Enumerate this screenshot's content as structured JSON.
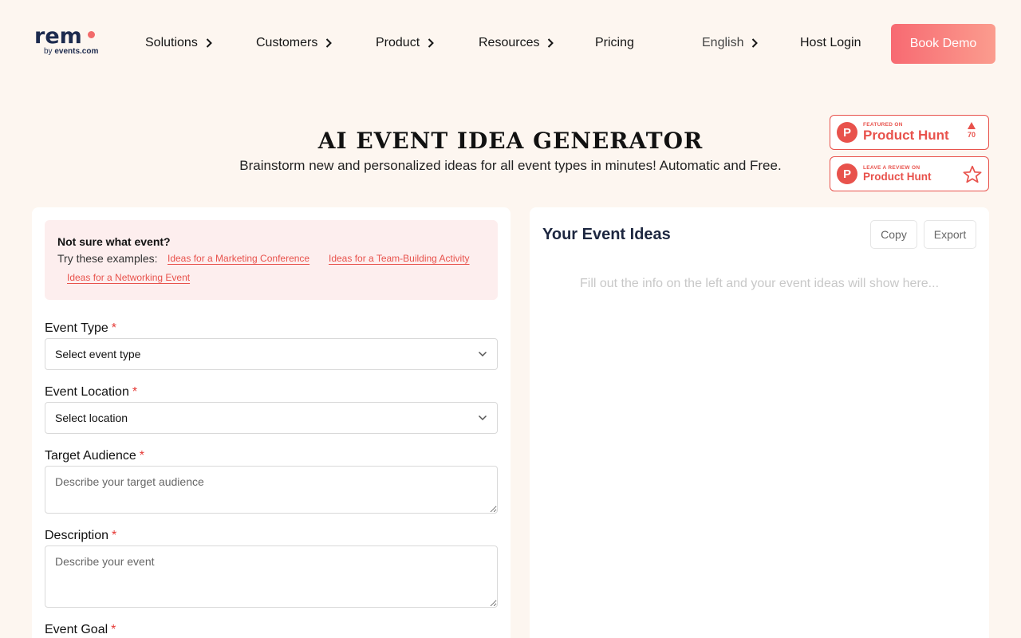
{
  "nav": {
    "logo": {
      "word": "rem",
      "sub_prefix": "by ",
      "sub_brand": "events.com"
    },
    "items": [
      {
        "label": "Solutions"
      },
      {
        "label": "Customers"
      },
      {
        "label": "Product"
      },
      {
        "label": "Resources"
      },
      {
        "label": "Pricing"
      }
    ],
    "language": "English",
    "host_login": "Host Login",
    "book_demo": "Book Demo"
  },
  "hero": {
    "title": "AI EVENT IDEA GENERATOR",
    "subtitle": "Brainstorm new and personalized ideas for all event types in minutes! Automatic and Free."
  },
  "badges": {
    "featured": {
      "logo": "P",
      "small": "FEATURED ON",
      "big": "Product Hunt",
      "votes": "70"
    },
    "review": {
      "logo": "P",
      "small": "LEAVE A REVIEW ON",
      "big": "Product Hunt"
    }
  },
  "form": {
    "examples": {
      "title": "Not sure what event?",
      "try_label": "Try these examples:",
      "links": [
        "Ideas for a Marketing Conference",
        "Ideas for a Team-Building Activity",
        "Ideas for a Networking Event"
      ]
    },
    "required_mark": "*",
    "event_type": {
      "label": "Event Type",
      "value": "Select event type"
    },
    "event_location": {
      "label": "Event Location",
      "value": "Select location"
    },
    "target_audience": {
      "label": "Target Audience",
      "placeholder": "Describe your target audience"
    },
    "description": {
      "label": "Description",
      "placeholder": "Describe your event"
    },
    "event_goal": {
      "label": "Event Goal"
    }
  },
  "results": {
    "title": "Your Event Ideas",
    "copy": "Copy",
    "export": "Export",
    "empty": "Fill out the info on the left and your event ideas will show here..."
  },
  "colors": {
    "background": "#fdf6f0",
    "accent": "#e8524c",
    "demo_gradient_start": "#f76a72",
    "demo_gradient_end": "#fb9c8e",
    "heading_navy": "#1d2740"
  },
  "icons": {
    "nav_chevron": "chevron-right-icon",
    "select_chevron": "chevron-down-icon",
    "vote": "upvote-triangle-icon",
    "review": "star-outline-icon"
  }
}
